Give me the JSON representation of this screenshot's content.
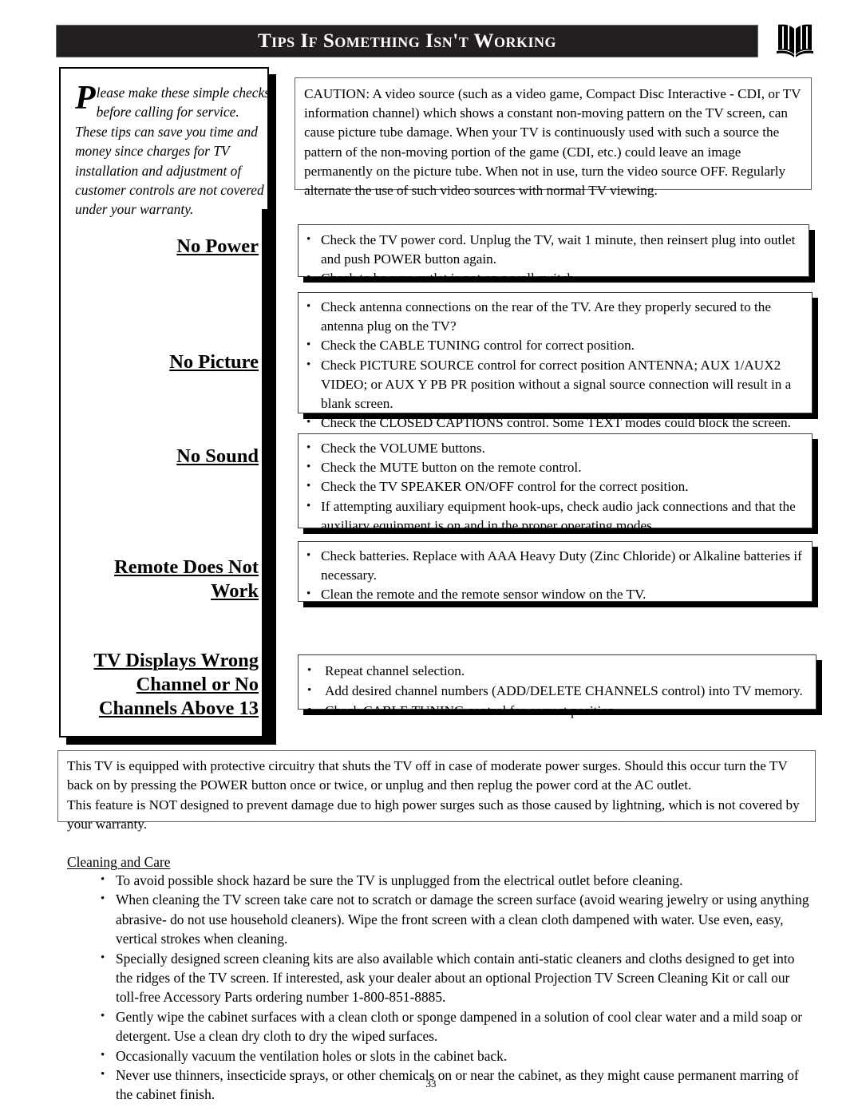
{
  "header": {
    "title": "Tips If Something Isn't Working",
    "icon": "open-book-icon",
    "bar_color": "#231f20",
    "text_color": "#ffffff"
  },
  "intro": {
    "dropcap": "P",
    "text": "lease make these simple checks before calling for service.  These tips can save you time and money since charges for TV installation and adjustment of customer controls are not covered under your warranty."
  },
  "caution": {
    "text": "CAUTION: A video source (such as a video game, Compact Disc Interactive - CDI, or TV information channel) which shows a constant non-moving pattern on the TV screen, can cause picture tube damage. When your TV is continuously used with such a source the pattern of the non-moving portion of the game (CDI, etc.) could leave an image permanently on the picture tube. When not in use, turn the video source OFF. Regularly alternate the use of such video sources with normal TV viewing."
  },
  "sections": [
    {
      "heading": "No Power",
      "items": [
        "Check the TV power cord. Unplug the TV, wait 1 minute, then reinsert plug into outlet and push POWER button again.",
        "Check to be sure outlet is not on a wall switch."
      ]
    },
    {
      "heading": "No Picture",
      "items": [
        "Check antenna connections on the rear of the TV. Are they properly secured to the antenna plug on the TV?",
        "Check the CABLE TUNING control for correct position.",
        "Check PICTURE SOURCE control for correct position ANTENNA; AUX 1/AUX2 VIDEO; or AUX Y PB PR  position without a signal source connection will result in a blank screen.",
        "Check the CLOSED CAPTIONS control. Some TEXT modes could block the screen."
      ]
    },
    {
      "heading": "No Sound",
      "items": [
        "Check the VOLUME buttons.",
        "Check the MUTE button on the remote control.",
        "Check the TV SPEAKER ON/OFF control for the correct position.",
        "If attempting auxiliary equipment hook-ups, check audio jack connections and that the auxiliary equipment is on and in the proper operating modes."
      ]
    },
    {
      "heading": "Remote Does Not Work",
      "items": [
        "Check batteries.  Replace with AAA Heavy Duty (Zinc Chloride) or Alkaline batteries if necessary.",
        "Clean the remote and the remote sensor window on the TV."
      ]
    },
    {
      "heading": "TV Displays Wrong Channel or No Channels Above 13",
      "items": [
        "Repeat channel selection.",
        "Add desired channel numbers (ADD/DELETE CHANNELS control) into TV memory.",
        "Check CABLE TUNING control for correct position."
      ]
    }
  ],
  "surge": {
    "paragraph_1": "This TV is equipped with protective circuitry that shuts the TV off in case of moderate power surges. Should this occur turn the TV back on by pressing the POWER button once or twice, or unplug and then replug the power cord at the AC outlet.",
    "paragraph_2": "This feature is NOT designed to prevent damage due to high power surges such as those caused by lightning, which is not covered by your warranty."
  },
  "cleaning": {
    "title": "Cleaning and Care",
    "items": [
      "To avoid possible shock hazard be sure the TV is unplugged from the electrical outlet before cleaning.",
      "When cleaning the TV screen take care not to scratch or damage the screen surface (avoid wearing jewelry or using anything abrasive- do not use household cleaners). Wipe the front screen with a clean cloth dampened with water. Use even, easy, vertical strokes when cleaning.",
      "Specially designed screen cleaning kits are also available which contain anti-static cleaners and cloths designed to get into the ridges of the TV screen. If interested, ask your dealer about an optional Projection TV Screen Cleaning Kit or call our toll-free Accessory Parts ordering number 1-800-851-8885.",
      "Gently wipe the cabinet surfaces with a clean cloth or sponge dampened in a solution of cool clear water and a mild soap or detergent. Use a clean dry cloth to dry the wiped surfaces.",
      "Occasionally vacuum the ventilation holes or slots in the cabinet back.",
      "Never use thinners, insecticide sprays, or other chemicals on or near the cabinet, as they might cause permanent marring of the cabinet finish."
    ]
  },
  "page_number": "33"
}
